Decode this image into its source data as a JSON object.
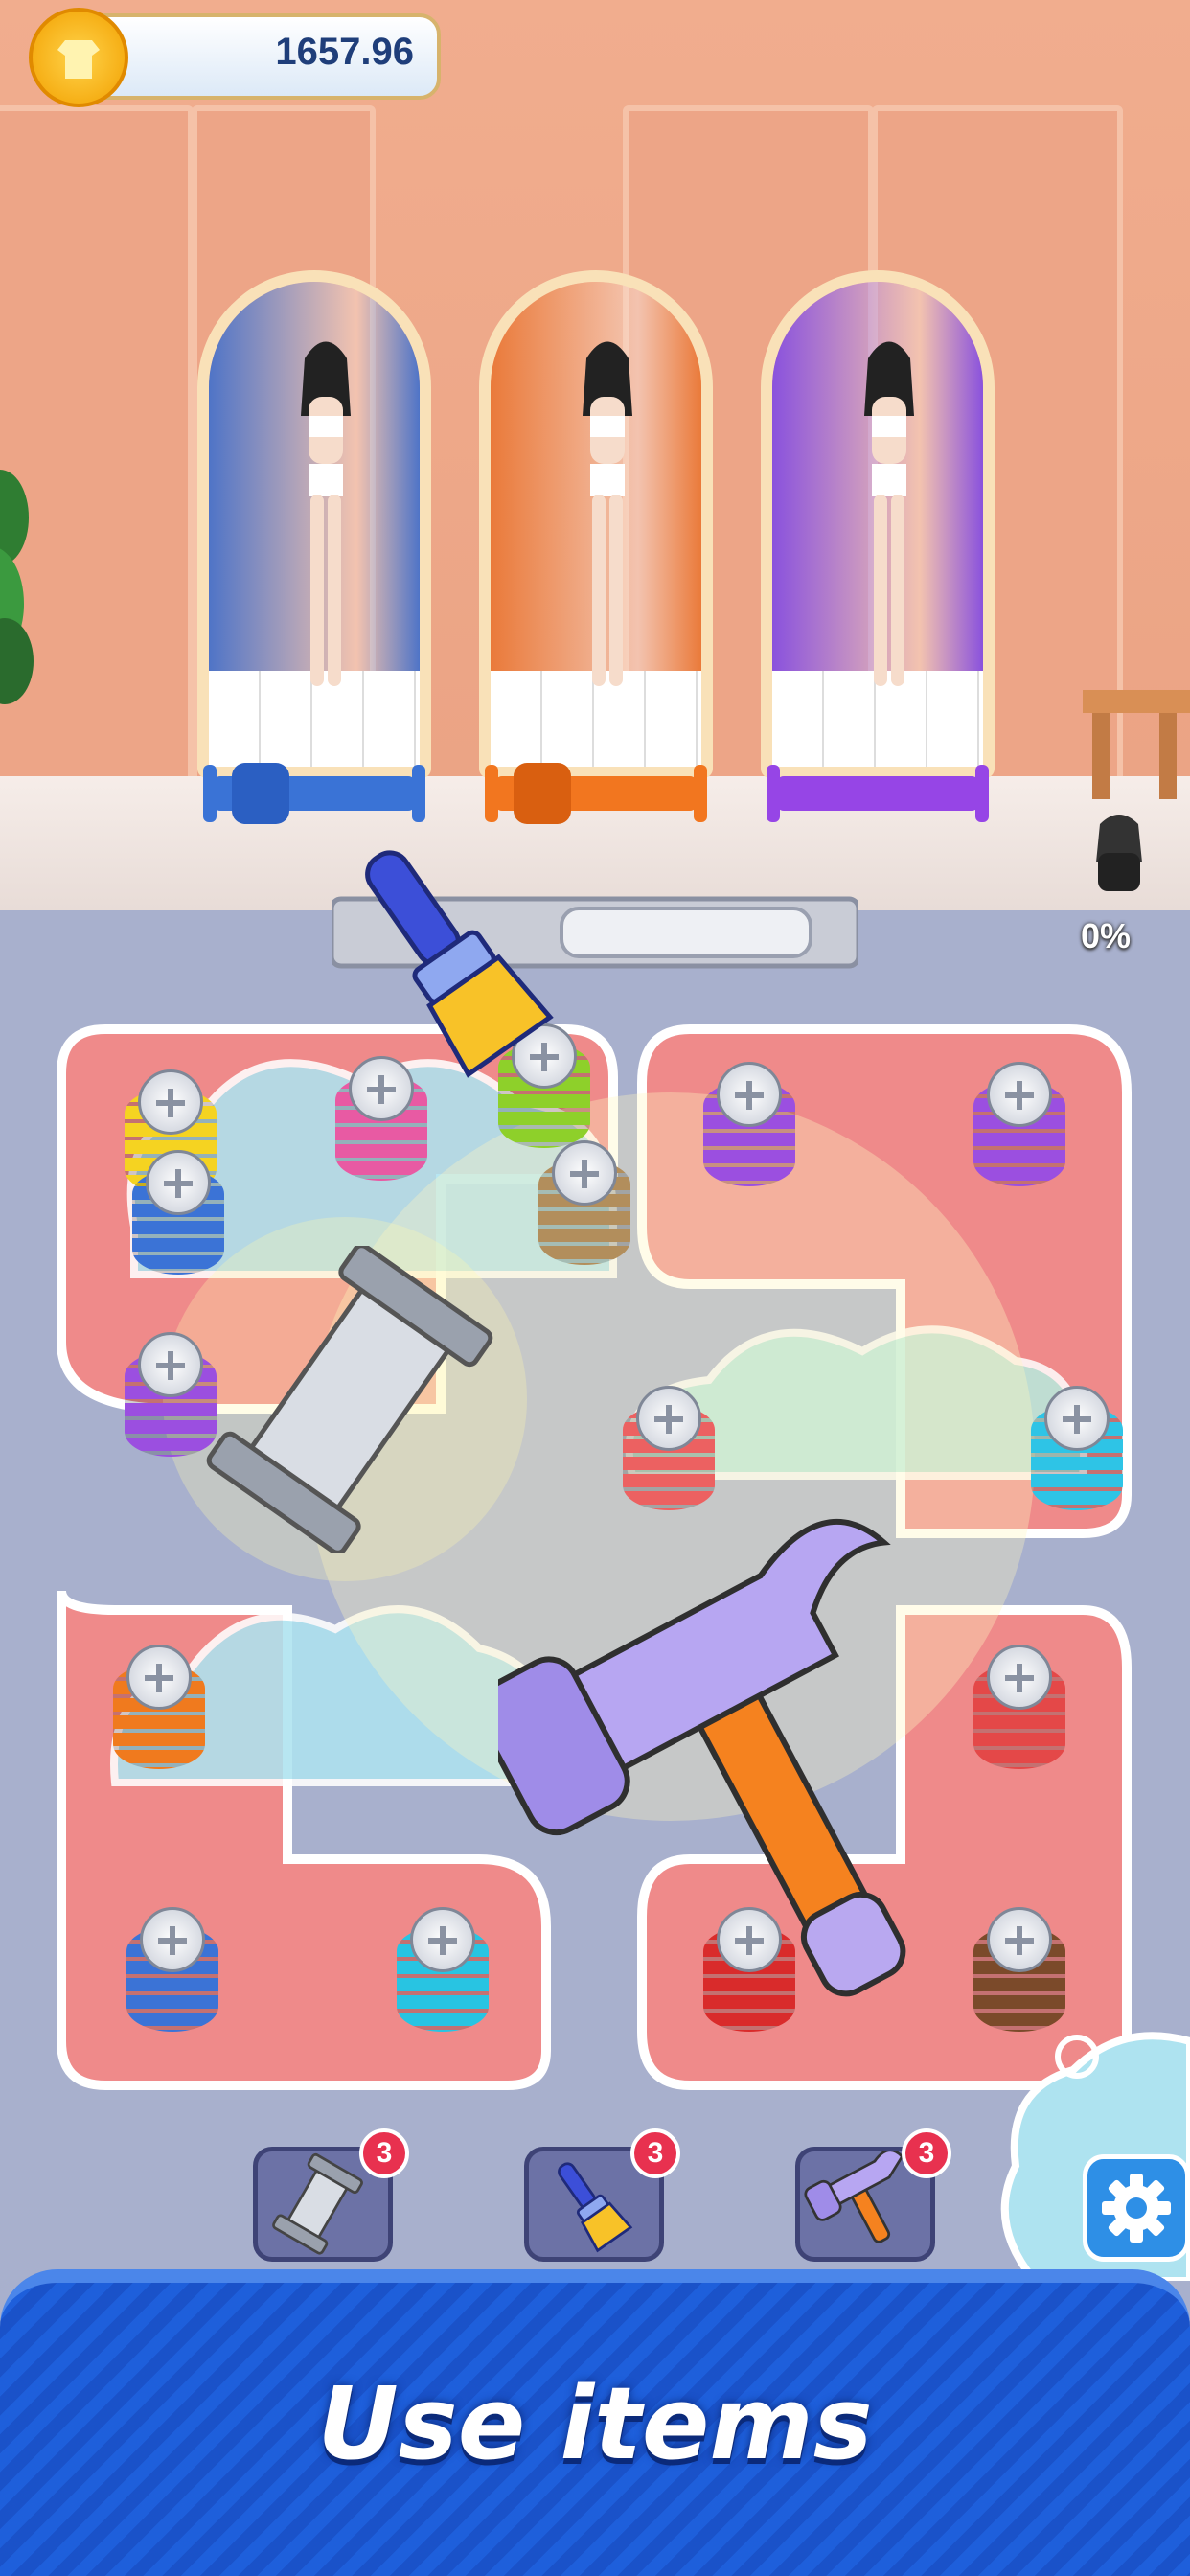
{
  "hud": {
    "coins": "1657.96",
    "progress": "0%"
  },
  "booths": [
    {
      "color": "#4f74c7",
      "spool_color": "#3a73d6"
    },
    {
      "color": "#ea7a3a",
      "spool_color": "#f2761f"
    },
    {
      "color": "#8a52dd",
      "spool_color": "#9645e6"
    }
  ],
  "board": {
    "screws": [
      {
        "color": "#f5d321"
      },
      {
        "color": "#e85aa3"
      },
      {
        "color": "#8ed02a"
      },
      {
        "color": "#3b73d6"
      },
      {
        "color": "#b28e5c"
      },
      {
        "color": "#9b4fe0"
      },
      {
        "color": "#9b4fe0"
      },
      {
        "color": "#9b4fe0"
      },
      {
        "color": "#2ec4e6"
      },
      {
        "color": "#ec6161"
      },
      {
        "color": "#f07a1e"
      },
      {
        "color": "#e44848"
      },
      {
        "color": "#3b73d6"
      },
      {
        "color": "#28c4e2"
      },
      {
        "color": "#d92b2b"
      },
      {
        "color": "#7b4a2a"
      }
    ]
  },
  "items": [
    {
      "name": "spool",
      "count": "3"
    },
    {
      "name": "brush",
      "count": "3"
    },
    {
      "name": "hammer",
      "count": "3"
    }
  ],
  "banner": {
    "text": "Use items"
  }
}
